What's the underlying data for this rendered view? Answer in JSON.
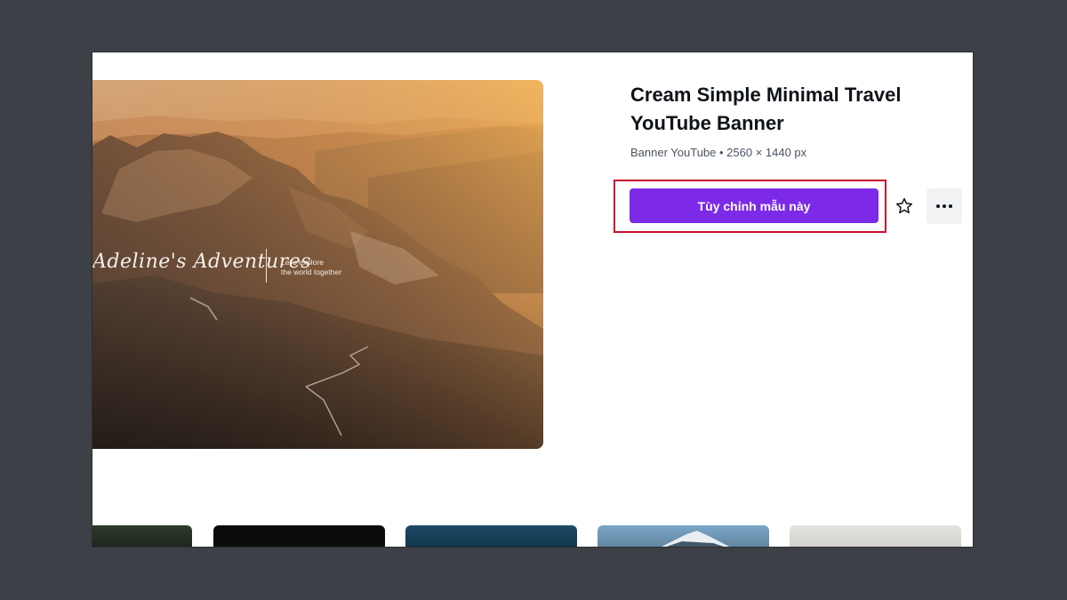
{
  "template": {
    "title": "Cream Simple Minimal Travel YouTube Banner",
    "meta": "Banner YouTube • 2560 × 1440 px"
  },
  "preview": {
    "script_text": "Adeline's Adventures",
    "tagline_line1": "Let's explore",
    "tagline_line2": "the world together"
  },
  "actions": {
    "customize_label": "Tùy chỉnh mẫu này",
    "favorite_icon": "star-icon",
    "more_icon": "more-horizontal-icon"
  },
  "colors": {
    "primary_button": "#7d2ae8",
    "highlight_border": "#c8102e",
    "backdrop": "#3d4147"
  },
  "related_templates": [
    {
      "name": "forest-thumbnail"
    },
    {
      "name": "dark-thumbnail"
    },
    {
      "name": "ocean-thumbnail"
    },
    {
      "name": "mountain-snow-thumbnail"
    },
    {
      "name": "mist-thumbnail"
    }
  ]
}
